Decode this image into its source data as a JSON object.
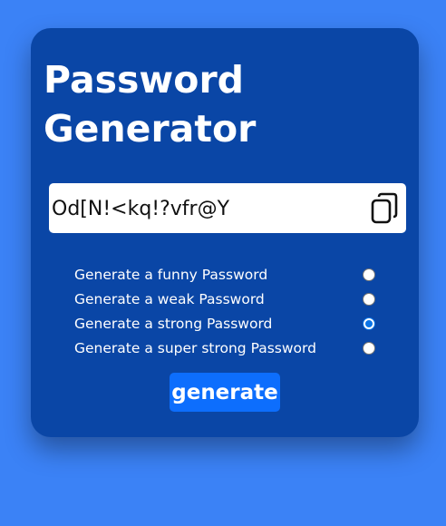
{
  "app": {
    "title": "Password Generator"
  },
  "output": {
    "password": "Od[N!<kq!?vfr@Y",
    "copy_icon": "copy-icon"
  },
  "options": [
    {
      "label": "Generate a funny Password",
      "selected": false
    },
    {
      "label": "Generate a weak Password",
      "selected": false
    },
    {
      "label": "Generate a strong Password",
      "selected": true
    },
    {
      "label": "Generate a super strong Password",
      "selected": false
    }
  ],
  "generate_button": {
    "label": "generate"
  },
  "colors": {
    "page_background": "#3b82f6",
    "card_background": "#0a46a6",
    "button_background": "#0d6efd",
    "radio_selected": "#0b74e6",
    "text": "#ffffff"
  }
}
